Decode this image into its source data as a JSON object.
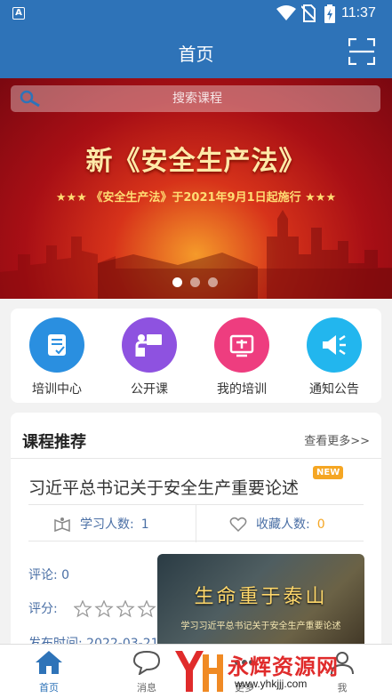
{
  "status_bar": {
    "time": "11:37",
    "app_badge": "A"
  },
  "nav": {
    "title": "首页"
  },
  "search": {
    "placeholder": "搜索课程"
  },
  "banner": {
    "headline": "新《安全生产法》",
    "subtitle": "★★★ 《安全生产法》于2021年9月1日起施行 ★★★",
    "slide_count": 3,
    "active_slide": 1
  },
  "quick_nav": [
    {
      "label": "培训中心",
      "icon": "training-center-icon",
      "color": "#2a8fe0"
    },
    {
      "label": "公开课",
      "icon": "open-class-icon",
      "color": "#8e52e0"
    },
    {
      "label": "我的培训",
      "icon": "my-training-icon",
      "color": "#ee3d7f"
    },
    {
      "label": "通知公告",
      "icon": "announcement-icon",
      "color": "#22b6ee"
    }
  ],
  "recommend": {
    "title": "课程推荐",
    "more": "查看更多>>",
    "course": {
      "title": "习近平总书记关于安全生产重要论述",
      "badge": "NEW",
      "learners_label": "学习人数:",
      "learners": "1",
      "favorites_label": "收藏人数:",
      "favorites": "0",
      "comments_label": "评论:",
      "comments": "0",
      "rating_label": "评分:",
      "rating": 0,
      "date_label": "发布时间:",
      "date": "2022-03-21",
      "thumb_title": "生命重于泰山",
      "thumb_subtitle": "学习习近平总书记关于安全生产重要论述"
    }
  },
  "tabs": [
    {
      "label": "首页",
      "icon": "home-icon"
    },
    {
      "label": "消息",
      "icon": "message-icon"
    },
    {
      "label": "更多",
      "icon": "more-icon"
    },
    {
      "label": "我",
      "icon": "profile-icon"
    }
  ],
  "watermark": {
    "title": "永辉资源网",
    "url": "www.yhkjjj.com"
  },
  "colors": {
    "primary": "#2e73b8",
    "accent": "#f5a623",
    "link": "#4a6fa5"
  }
}
